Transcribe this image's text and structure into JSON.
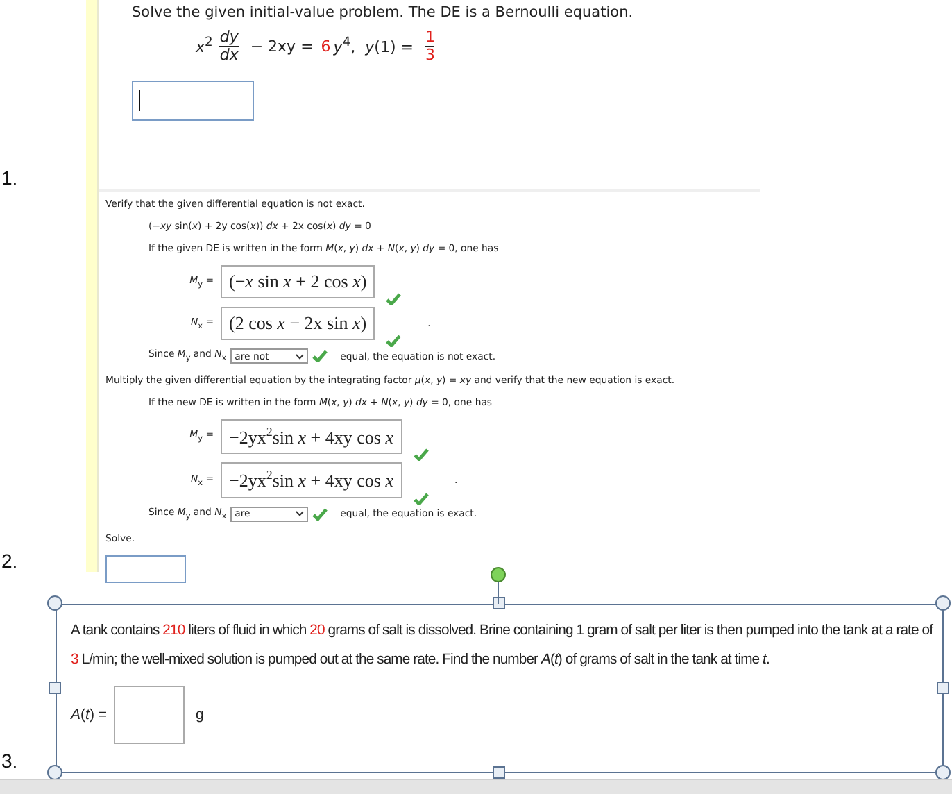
{
  "questions": [
    {
      "kind": "bernoulli",
      "number": "1.",
      "prompt": "Solve the given initial-value problem. The DE is a Bernoulli equation.",
      "equation": [
        {
          "kind": "text",
          "text": "*x*$^{2}$"
        },
        {
          "kind": "frac",
          "num": "*dy*",
          "den": "*dx*"
        },
        {
          "kind": "text",
          "text": " − 2xy = "
        },
        {
          "kind": "text",
          "text": "6",
          "highlight": true
        },
        {
          "kind": "text",
          "text": "*y*$^{4}$,  *y*(1) = "
        },
        {
          "kind": "frac",
          "num": "1",
          "den": "3",
          "highlight": true
        }
      ],
      "answer": {
        "focused": true
      }
    },
    {
      "kind": "exact",
      "number": "2.",
      "parts": [
        {
          "kind": "text",
          "text": "Verify that the given differential equation is not exact."
        },
        {
          "kind": "formula",
          "text": "(−*xy* sin(*x*) + 2y cos(*x*)) *dx* + 2x cos(*x*) *dy* = 0"
        },
        {
          "kind": "formula",
          "text": "If the given DE is written in the form *M*(*x*, *y*) *dx* + *N*(*x*, *y*) *dy* = 0, one has"
        },
        {
          "kind": "math_answer",
          "label": "*M*$_{y}$ =",
          "value": "(−*x* sin *x* + 2 cos *x*)",
          "correct": true
        },
        {
          "kind": "math_answer",
          "label": "*N*$_{x}$ =",
          "value": "(2 cos *x* − 2x sin *x*)",
          "correct": true,
          "trailing": "."
        },
        {
          "kind": "dropdown",
          "before": "Since *M*$_{y}$ and *N*$_{x}$",
          "value": "are not",
          "correct": true,
          "after": "equal, the equation is not exact."
        },
        {
          "kind": "text",
          "text": "Multiply the given differential equation by the integrating factor *μ*(*x*, *y*) = *xy* and verify that the new equation is exact."
        },
        {
          "kind": "formula",
          "text": "If the new DE is written in the form *M*(*x*, *y*) *dx* + *N*(*x*, *y*) *dy* = 0, one has"
        },
        {
          "kind": "math_answer",
          "label": "*M*$_{y}$ =",
          "value": "−2yx$^{2}$sin *x* + 4xy cos *x*",
          "correct": true
        },
        {
          "kind": "math_answer",
          "label": "*N*$_{x}$ =",
          "value": "−2yx$^{2}$sin *x* + 4xy cos *x*",
          "correct": true,
          "trailing": "."
        },
        {
          "kind": "dropdown",
          "before": "Since *M*$_{y}$ and *N*$_{x}$",
          "value": "are",
          "correct": true,
          "after": "equal, the equation is exact."
        },
        {
          "kind": "text",
          "text": "Solve."
        },
        {
          "kind": "input"
        }
      ]
    },
    {
      "kind": "word_problem",
      "number": "3.",
      "selected": true,
      "segments": [
        {
          "text": "A tank contains "
        },
        {
          "text": "210",
          "highlight": true
        },
        {
          "text": " liters of fluid in which "
        },
        {
          "text": "20",
          "highlight": true
        },
        {
          "text": " grams of salt is dissolved. Brine containing 1 gram of salt per liter is then pumped into the tank at a rate of "
        },
        {
          "text": "3",
          "highlight": true
        },
        {
          "text": " L/min; the well-mixed solution is pumped out at the same rate. Find the number *A*(*t*) of grams of salt in the tank at time *t*."
        }
      ],
      "answer": {
        "label": "*A*(*t*) =",
        "unit": "g"
      }
    }
  ]
}
